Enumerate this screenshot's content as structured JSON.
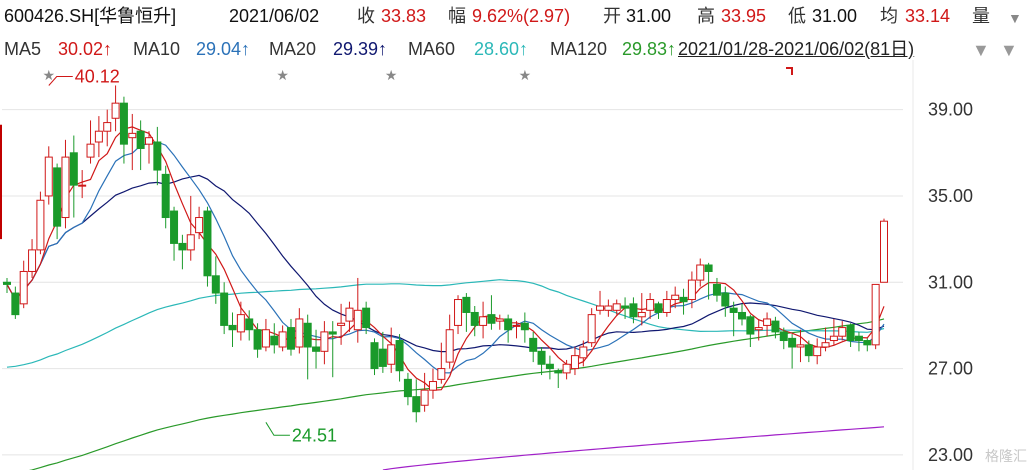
{
  "header": {
    "stock": "600426.SH[华鲁恒升]",
    "date": "2021/06/02",
    "close_label": "收",
    "close": "33.83",
    "change_label": "幅",
    "change": "9.62%(2.97)",
    "open_label": "开",
    "open": "31.00",
    "high_label": "高",
    "high": "33.95",
    "low_label": "低",
    "low": "31.00",
    "avg_label": "均",
    "avg": "33.14",
    "volume_label": "量"
  },
  "ma_bar": {
    "ma5_label": "MA5",
    "ma5": "30.02↑",
    "ma10_label": "MA10",
    "ma10": "29.04↑",
    "ma20_label": "MA20",
    "ma20": "29.39↑",
    "ma60_label": "MA60",
    "ma60": "28.60↑",
    "ma120_label": "MA120",
    "ma120": "29.83↑",
    "overlap_text": "2021/01/28-2021/06/02(81日)"
  },
  "colors": {
    "up": "#d01818",
    "down": "#1a9a2a",
    "ma5": "#d01818",
    "ma10": "#2b72b8",
    "ma20": "#101870",
    "ma60": "#2bb8b8",
    "ma120": "#2a9a2a",
    "ma250": "#a020c8"
  },
  "icons": [
    "star-marker-icon",
    "dropdown-triangle-icon",
    "watermark-logo-icon"
  ],
  "watermark": "格隆汇",
  "chart_data": {
    "type": "candlestick",
    "y_ticks": [
      "39.00",
      "35.00",
      "31.00",
      "27.00",
      "23.00"
    ],
    "ylim": [
      22.3,
      41.3
    ],
    "annotations": [
      {
        "text": "40.12",
        "index": 5,
        "price": 40.12,
        "kind": "high"
      },
      {
        "text": "24.51",
        "index": 31,
        "price": 24.51,
        "kind": "low"
      }
    ],
    "star_markers": [
      5,
      33,
      46,
      62
    ],
    "ohlc": [
      [
        31.0,
        30.9,
        31.2,
        30.5
      ],
      [
        30.5,
        29.5,
        30.8,
        29.3
      ],
      [
        30.0,
        31.5,
        32.0,
        29.8
      ],
      [
        31.5,
        32.5,
        33.0,
        31.2
      ],
      [
        32.5,
        34.8,
        35.2,
        32.3
      ],
      [
        35.0,
        36.8,
        37.3,
        34.6
      ],
      [
        36.3,
        33.6,
        36.5,
        33.0
      ],
      [
        34.0,
        36.8,
        37.6,
        33.5
      ],
      [
        37.0,
        35.5,
        37.8,
        34.0
      ],
      [
        35.5,
        35.5,
        36.2,
        34.9
      ],
      [
        36.8,
        37.4,
        38.5,
        36.5
      ],
      [
        37.5,
        38.0,
        38.7,
        36.8
      ],
      [
        38.0,
        38.4,
        39.0,
        37.3
      ],
      [
        38.6,
        39.3,
        40.12,
        38.0
      ],
      [
        39.3,
        37.4,
        39.6,
        36.5
      ],
      [
        37.7,
        37.9,
        38.8,
        36.2
      ],
      [
        38.0,
        37.2,
        38.5,
        36.2
      ],
      [
        37.4,
        37.7,
        38.0,
        36.5
      ],
      [
        37.5,
        36.2,
        38.2,
        35.5
      ],
      [
        36.0,
        34.0,
        36.4,
        33.5
      ],
      [
        34.3,
        32.8,
        34.5,
        32.0
      ],
      [
        32.8,
        32.5,
        33.2,
        31.6
      ],
      [
        32.5,
        33.2,
        35.0,
        32.0
      ],
      [
        33.3,
        34.0,
        34.5,
        33.0
      ],
      [
        34.3,
        31.3,
        34.5,
        30.8
      ],
      [
        31.3,
        30.5,
        32.2,
        30.0
      ],
      [
        30.5,
        29.0,
        31.0,
        28.6
      ],
      [
        29.0,
        28.8,
        29.6,
        28.0
      ],
      [
        28.7,
        29.5,
        30.1,
        28.3
      ],
      [
        29.3,
        28.8,
        29.7,
        28.3
      ],
      [
        28.8,
        27.9,
        29.1,
        27.5
      ],
      [
        28.0,
        28.8,
        29.3,
        27.8
      ],
      [
        28.5,
        28.1,
        29.1,
        27.7
      ],
      [
        28.0,
        28.7,
        29.0,
        27.8
      ],
      [
        28.9,
        27.9,
        29.3,
        27.6
      ],
      [
        28.0,
        29.3,
        29.8,
        27.7
      ],
      [
        29.1,
        28.0,
        29.5,
        26.5
      ],
      [
        28.0,
        27.8,
        28.8,
        27.0
      ],
      [
        27.8,
        28.7,
        29.2,
        27.2
      ],
      [
        28.7,
        28.6,
        29.2,
        26.6
      ],
      [
        29.0,
        29.1,
        30.0,
        28.1
      ],
      [
        29.2,
        29.8,
        30.1,
        28.7
      ],
      [
        28.8,
        29.7,
        31.2,
        28.2
      ],
      [
        29.8,
        28.9,
        30.1,
        28.6
      ],
      [
        28.2,
        27.0,
        28.4,
        26.7
      ],
      [
        27.9,
        27.1,
        28.7,
        26.8
      ],
      [
        27.2,
        28.1,
        28.9,
        26.8
      ],
      [
        28.3,
        26.9,
        28.6,
        26.4
      ],
      [
        26.5,
        25.7,
        26.8,
        25.3
      ],
      [
        25.7,
        25.0,
        26.5,
        24.51
      ],
      [
        25.3,
        26.0,
        26.8,
        25.0
      ],
      [
        26.0,
        26.4,
        27.0,
        25.6
      ],
      [
        26.5,
        27.0,
        28.2,
        26.3
      ],
      [
        27.3,
        28.8,
        29.5,
        27.0
      ],
      [
        29.0,
        30.2,
        30.4,
        28.6
      ],
      [
        30.3,
        29.6,
        30.5,
        28.7
      ],
      [
        29.6,
        29.0,
        29.9,
        28.5
      ],
      [
        29.0,
        29.4,
        30.1,
        28.4
      ],
      [
        29.5,
        29.1,
        30.4,
        28.8
      ],
      [
        29.2,
        29.3,
        29.5,
        28.8
      ],
      [
        29.3,
        28.8,
        29.5,
        28.2
      ],
      [
        29.0,
        29.0,
        29.2,
        28.4
      ],
      [
        29.1,
        28.8,
        29.6,
        28.2
      ],
      [
        28.4,
        27.8,
        28.7,
        27.3
      ],
      [
        27.8,
        27.2,
        28.0,
        26.7
      ],
      [
        27.2,
        27.0,
        27.6,
        26.5
      ],
      [
        26.9,
        26.8,
        27.0,
        26.1
      ],
      [
        26.8,
        27.2,
        27.4,
        26.5
      ],
      [
        27.0,
        27.6,
        28.0,
        26.7
      ],
      [
        27.5,
        28.0,
        28.3,
        27.1
      ],
      [
        28.2,
        29.5,
        29.8,
        28.0
      ],
      [
        29.7,
        29.9,
        30.6,
        29.5
      ],
      [
        29.7,
        29.9,
        30.2,
        29.4
      ],
      [
        29.7,
        30.0,
        30.2,
        29.5
      ],
      [
        29.9,
        29.8,
        30.3,
        29.3
      ],
      [
        30.0,
        29.4,
        30.3,
        29.1
      ],
      [
        29.4,
        29.6,
        30.5,
        29.0
      ],
      [
        29.7,
        30.2,
        30.5,
        29.3
      ],
      [
        30.0,
        29.6,
        30.1,
        29.3
      ],
      [
        29.6,
        30.2,
        30.6,
        29.4
      ],
      [
        30.2,
        30.4,
        30.8,
        29.8
      ],
      [
        30.3,
        30.1,
        30.7,
        29.5
      ],
      [
        30.2,
        31.1,
        31.5,
        29.8
      ],
      [
        31.1,
        31.8,
        32.1,
        30.8
      ],
      [
        31.8,
        31.5,
        31.9,
        30.2
      ],
      [
        30.9,
        30.4,
        31.2,
        30.1
      ],
      [
        30.5,
        29.9,
        30.8,
        29.4
      ],
      [
        29.8,
        29.6,
        30.1,
        28.5
      ],
      [
        29.6,
        29.3,
        30.0,
        29.0
      ],
      [
        29.4,
        28.6,
        29.5,
        28.0
      ],
      [
        28.8,
        28.9,
        29.3,
        28.3
      ],
      [
        29.0,
        29.3,
        29.6,
        28.5
      ],
      [
        29.2,
        28.7,
        29.4,
        28.4
      ],
      [
        28.7,
        28.3,
        28.9,
        27.9
      ],
      [
        28.4,
        28.0,
        28.6,
        27.0
      ],
      [
        28.0,
        28.1,
        28.8,
        27.3
      ],
      [
        28.1,
        27.6,
        28.3,
        27.3
      ],
      [
        27.6,
        28.0,
        28.4,
        27.2
      ],
      [
        28.0,
        28.2,
        28.9,
        27.8
      ],
      [
        28.3,
        28.5,
        29.3,
        28.1
      ],
      [
        28.5,
        28.9,
        29.2,
        28.3
      ],
      [
        29.0,
        28.3,
        29.1,
        28.0
      ],
      [
        28.5,
        28.3,
        28.7,
        27.8
      ],
      [
        28.3,
        28.1,
        28.4,
        27.8
      ],
      [
        28.1,
        30.9,
        30.9,
        27.9
      ],
      [
        31.0,
        33.83,
        33.95,
        31.0
      ]
    ],
    "ma250": {
      "start_index": 45,
      "start": 22.3,
      "end": 24.3
    }
  }
}
